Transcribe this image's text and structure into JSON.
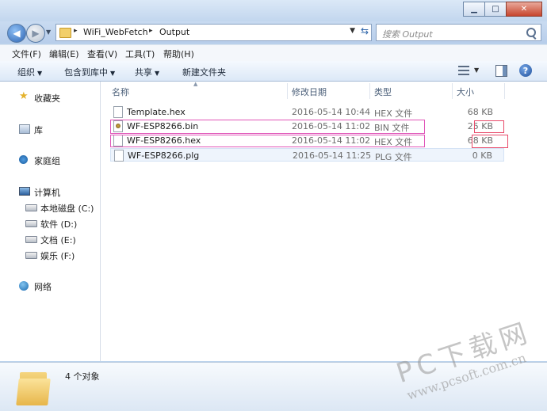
{
  "window": {
    "minimize_label": "▁",
    "maximize_label": "□",
    "close_label": "✕"
  },
  "address": {
    "crumbs": [
      "WiFi_WebFetch",
      "Output"
    ],
    "separator": "▸",
    "search_placeholder": "搜索 Output"
  },
  "menu": [
    "文件(F)",
    "编辑(E)",
    "查看(V)",
    "工具(T)",
    "帮助(H)"
  ],
  "toolbar": {
    "organize": "组织",
    "include_in_library": "包含到库中",
    "share": "共享",
    "new_folder": "新建文件夹"
  },
  "sidebar": {
    "favorites": "收藏夹",
    "libraries": "库",
    "homegroup": "家庭组",
    "computer": "计算机",
    "drives": [
      "本地磁盘 (C:)",
      "软件 (D:)",
      "文档 (E:)",
      "娱乐 (F:)"
    ],
    "network": "网络"
  },
  "columns": {
    "name": "名称",
    "modified": "修改日期",
    "type": "类型",
    "size": "大小"
  },
  "files": [
    {
      "name": "Template.hex",
      "date": "2016-05-14 10:44",
      "type": "HEX 文件",
      "size": "68 KB",
      "icon": "document-icon"
    },
    {
      "name": "WF-ESP8266.bin",
      "date": "2016-05-14 11:02",
      "type": "BIN 文件",
      "size": "25 KB",
      "icon": "bin-file-icon"
    },
    {
      "name": "WF-ESP8266.hex",
      "date": "2016-05-14 11:02",
      "type": "HEX 文件",
      "size": "68 KB",
      "icon": "document-icon"
    },
    {
      "name": "WF-ESP8266.plg",
      "date": "2016-05-14 11:25",
      "type": "PLG 文件",
      "size": "0 KB",
      "icon": "document-icon"
    }
  ],
  "status": {
    "count": "4 个对象"
  },
  "watermark": {
    "line1": "PC下载网",
    "line2": "www.pcsoft.com.cn"
  },
  "colors": {
    "highlight_row": "#e055b8",
    "highlight_size": "#e84a6a"
  }
}
